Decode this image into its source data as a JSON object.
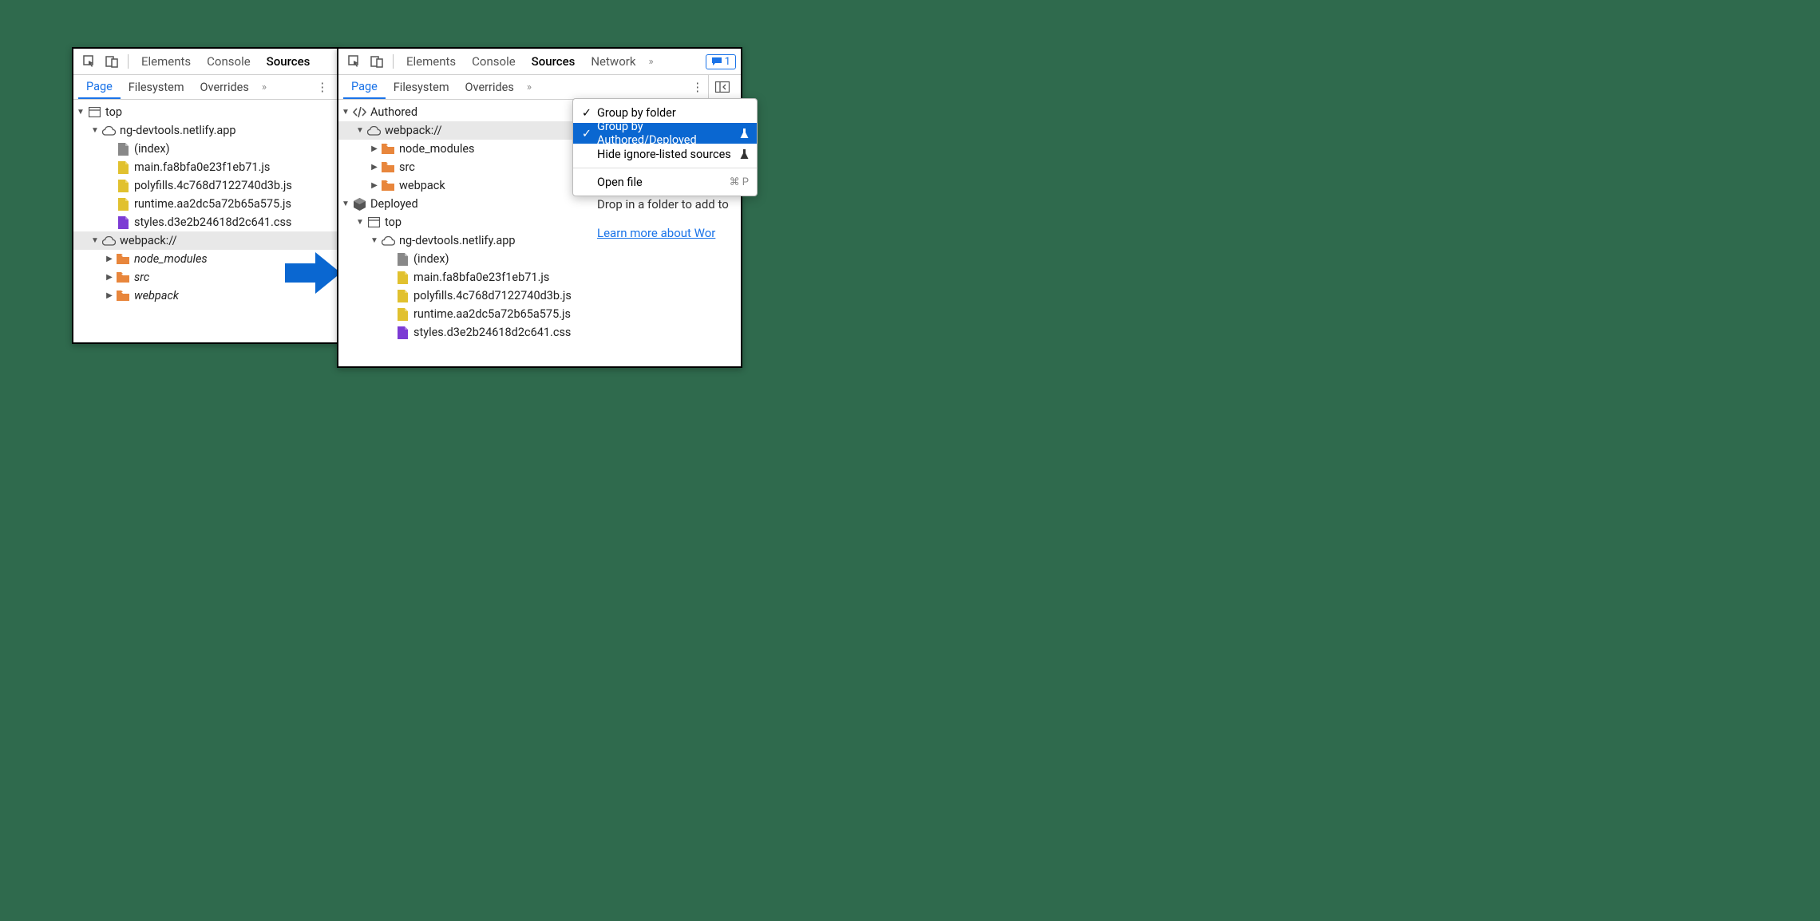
{
  "left": {
    "mainTabs": {
      "elements": "Elements",
      "console": "Console",
      "sources": "Sources"
    },
    "subTabs": {
      "page": "Page",
      "filesystem": "Filesystem",
      "overrides": "Overrides"
    },
    "tree": {
      "top": "top",
      "domain": "ng-devtools.netlify.app",
      "index": "(index)",
      "mainjs": "main.fa8bfa0e23f1eb71.js",
      "polyfills": "polyfills.4c768d7122740d3b.js",
      "runtime": "runtime.aa2dc5a72b65a575.js",
      "styles": "styles.d3e2b24618d2c641.css",
      "webpack": "webpack://",
      "nodeModules": "node_modules",
      "src": "src",
      "webpackFolder": "webpack"
    }
  },
  "right": {
    "mainTabs": {
      "elements": "Elements",
      "console": "Console",
      "sources": "Sources",
      "network": "Network"
    },
    "badge": "1",
    "subTabs": {
      "page": "Page",
      "filesystem": "Filesystem",
      "overrides": "Overrides"
    },
    "tree": {
      "authored": "Authored",
      "webpack": "webpack://",
      "nodeModules": "node_modules",
      "src": "src",
      "webpackFolder": "webpack",
      "deployed": "Deployed",
      "top": "top",
      "domain": "ng-devtools.netlify.app",
      "index": "(index)",
      "mainjs": "main.fa8bfa0e23f1eb71.js",
      "polyfills": "polyfills.4c768d7122740d3b.js",
      "runtime": "runtime.aa2dc5a72b65a575.js",
      "styles": "styles.d3e2b24618d2c641.css"
    },
    "menu": {
      "groupFolder": "Group by folder",
      "groupAuthored": "Group by Authored/Deployed",
      "hideIgnore": "Hide ignore-listed sources",
      "openFile": "Open file",
      "openFileShortcut": "⌘ P"
    },
    "dropText": "Drop in a folder to add to",
    "learnMore": "Learn more about Wor"
  }
}
